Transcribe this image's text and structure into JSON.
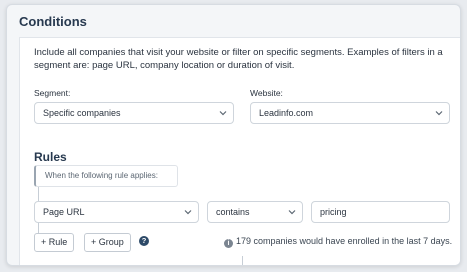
{
  "conditions": {
    "title": "Conditions",
    "description": "Include all companies that visit your website or filter on specific segments. Examples of filters in a segment are: page URL, company location or duration of visit."
  },
  "segment": {
    "label": "Segment:",
    "value": "Specific companies"
  },
  "website": {
    "label": "Website:",
    "value": "Leadinfo.com"
  },
  "rules": {
    "title": "Rules",
    "applies_text": "When the following rule applies:",
    "rule": {
      "field": "Page URL",
      "operator": "contains",
      "value": "pricing"
    },
    "add_rule_label": "+ Rule",
    "add_group_label": "+ Group",
    "help_glyph": "?",
    "info_glyph": "i",
    "enroll_text": "179 companies would have enrolled in the last 7 days."
  },
  "icons": {
    "chevron": "chevron-down-icon",
    "help": "question-circle-icon",
    "info": "info-circle-icon"
  }
}
